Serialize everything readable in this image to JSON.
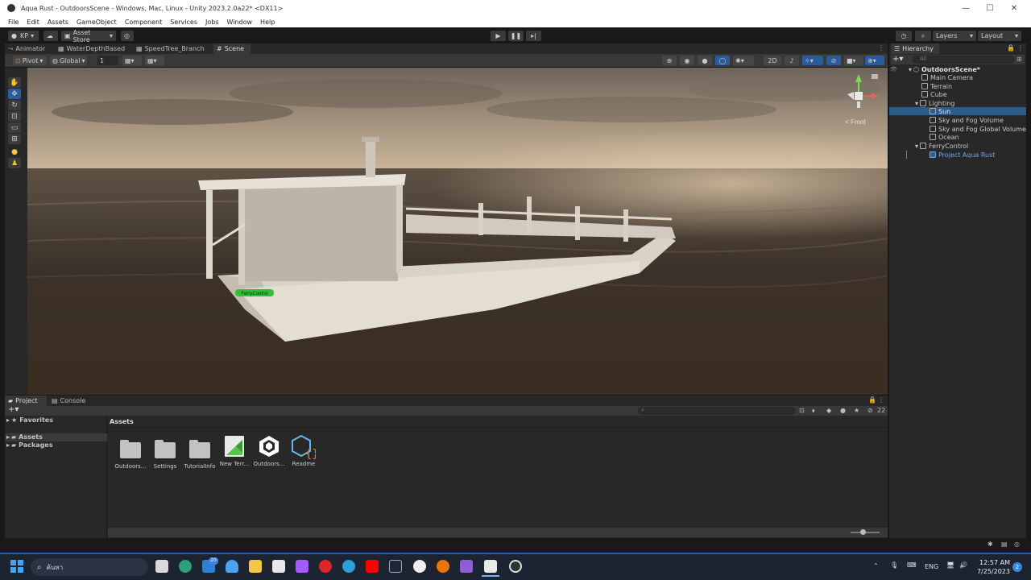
{
  "window": {
    "title": "Aqua Rust - OutdoorsScene - Windows, Mac, Linux - Unity 2023.2.0a22* <DX11>",
    "minimize": "—",
    "maximize": "☐",
    "close": "✕"
  },
  "menu": [
    "File",
    "Edit",
    "Assets",
    "GameObject",
    "Component",
    "Services",
    "Jobs",
    "Window",
    "Help"
  ],
  "toolbar": {
    "account": "KP",
    "asset_store": "Asset Store",
    "layers": "Layers",
    "layout": "Layout"
  },
  "tabs": [
    "Animator",
    "WaterDepthBased",
    "SpeedTree_Branch",
    "Scene"
  ],
  "scene_toolbar": {
    "pivot": "Pivot",
    "global": "Global",
    "grid_snap": "1",
    "mode_2d": "2D"
  },
  "scene": {
    "gizmo_label": "< Front",
    "object_label": "FerryControl"
  },
  "hierarchy": {
    "title": "Hierarchy",
    "search_placeholder": "All",
    "items": [
      {
        "label": "OutdoorsScene*",
        "depth": 0,
        "bold": true
      },
      {
        "label": "Main Camera",
        "depth": 1
      },
      {
        "label": "Terrain",
        "depth": 1
      },
      {
        "label": "Cube",
        "depth": 1
      },
      {
        "label": "Lighting",
        "depth": 1
      },
      {
        "label": "Sun",
        "depth": 2,
        "selected": true
      },
      {
        "label": "Sky and Fog Volume",
        "depth": 2
      },
      {
        "label": "Sky and Fog Global Volume",
        "depth": 2
      },
      {
        "label": "Ocean",
        "depth": 2
      },
      {
        "label": "FerryControl",
        "depth": 1
      },
      {
        "label": "Project Aqua Rust",
        "depth": 2,
        "prefab": true
      }
    ]
  },
  "project": {
    "tabs": [
      "Project",
      "Console"
    ],
    "favorites": "Favorites",
    "tree": [
      "Assets",
      "Packages"
    ],
    "breadcrumb": "Assets",
    "hidden_count": "22",
    "assets": [
      {
        "label": "Outdoors...",
        "kind": "folder"
      },
      {
        "label": "Settings",
        "kind": "folder"
      },
      {
        "label": "TutorialInfo",
        "kind": "folder"
      },
      {
        "label": "New Terr...",
        "kind": "terrain"
      },
      {
        "label": "Outdoors...",
        "kind": "unity"
      },
      {
        "label": "Readme",
        "kind": "script"
      }
    ]
  },
  "taskbar": {
    "search_placeholder": "ค้นหา",
    "badge": "20",
    "language": "ENG",
    "time": "12:57 AM",
    "date": "7/25/2023",
    "notification_count": "2"
  }
}
